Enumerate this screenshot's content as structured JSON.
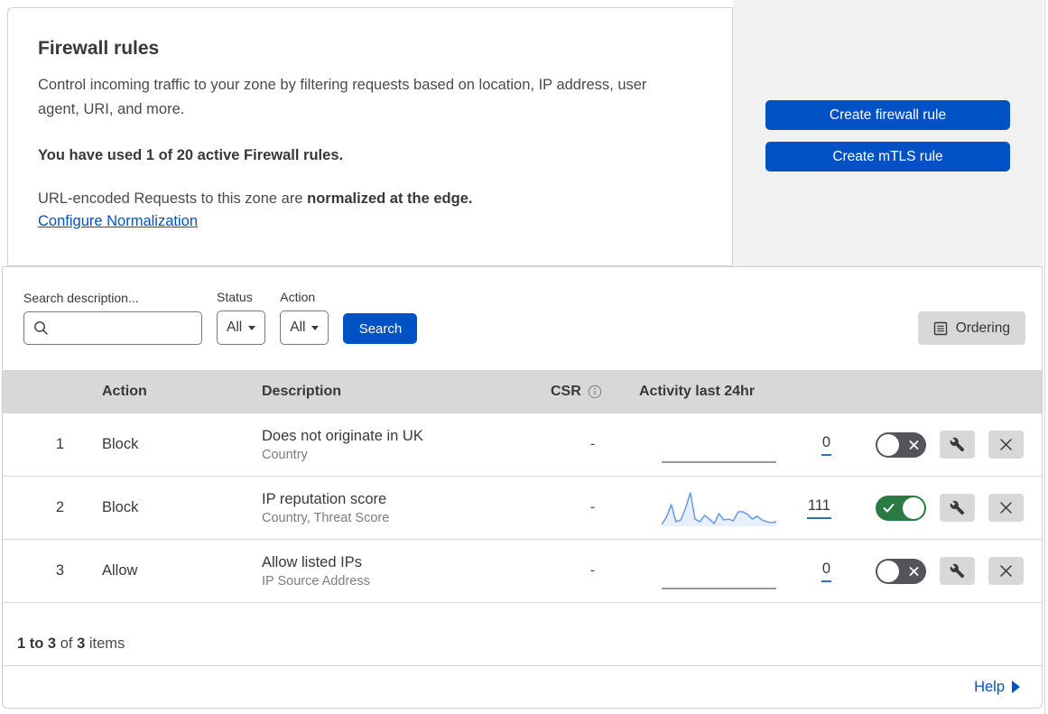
{
  "intro": {
    "title": "Firewall rules",
    "description": "Control incoming traffic to your zone by filtering requests based on location, IP address, user agent, URI, and more.",
    "usage_notice": "You have used 1 of 20 active Firewall rules.",
    "normalization_text": "URL-encoded Requests to this zone are",
    "normalization_bold": "normalized at the edge.",
    "normalization_link": "Configure Normalization"
  },
  "actions_panel": {
    "create_firewall_rule": "Create firewall rule",
    "create_mtls_rule": "Create mTLS rule"
  },
  "filters": {
    "search_label": "Search description...",
    "status_label": "Status",
    "status_value": "All",
    "action_label": "Action",
    "action_value": "All",
    "search_button": "Search",
    "ordering_button": "Ordering"
  },
  "table": {
    "headers": {
      "action": "Action",
      "description": "Description",
      "csr": "CSR",
      "activity": "Activity last 24hr"
    },
    "rows": [
      {
        "priority": "1",
        "action": "Block",
        "description": "Does not originate in UK",
        "match_fields": "Country",
        "csr": "-",
        "activity_count": "0",
        "enabled": false
      },
      {
        "priority": "2",
        "action": "Block",
        "description": "IP reputation score",
        "match_fields": "Country, Threat Score",
        "csr": "-",
        "activity_count": "111",
        "enabled": true,
        "sparkline": [
          2,
          10,
          24,
          5,
          7,
          20,
          37,
          8,
          5,
          12,
          8,
          3,
          14,
          7,
          8,
          6,
          16,
          16,
          13,
          8,
          11,
          7,
          5,
          4,
          5
        ]
      },
      {
        "priority": "3",
        "action": "Allow",
        "description": "Allow listed IPs",
        "match_fields": "IP Source Address",
        "csr": "-",
        "activity_count": "0",
        "enabled": false
      }
    ],
    "summary": {
      "range": "1 to 3",
      "of_text": "of",
      "total": "3",
      "items_text": "items"
    }
  },
  "help": {
    "label": "Help"
  },
  "colors": {
    "accent_blue": "#0051c3",
    "toggle_on_green": "#2b7a44",
    "toggle_off_gray": "#54555a",
    "sparkline_blue": "#6f9ee6",
    "table_header_bg": "#d8d8d8",
    "side_panel_bg": "#f1f1f1"
  }
}
